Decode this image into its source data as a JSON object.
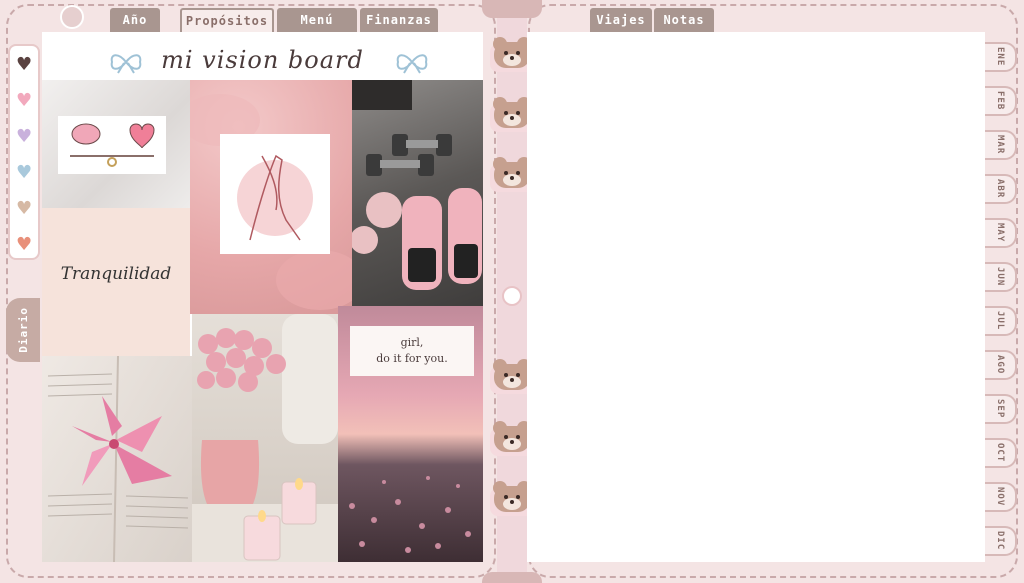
{
  "top_tabs": {
    "anio": "Año",
    "propositos": "Propósitos",
    "menu": "Menú",
    "finanzas": "Finanzas",
    "viajes": "Viajes",
    "notas": "Notas"
  },
  "side_tab": {
    "diario": "Diario"
  },
  "colors": {
    "heart_1": "#5a4240",
    "heart_2": "#f2a9bd",
    "heart_3": "#c9b1dc",
    "heart_4": "#a9c9dc",
    "heart_5": "#d6b9a4",
    "heart_6": "#e8907a",
    "tab_bg": "#a99690",
    "page_bg": "#f4e4e4"
  },
  "board": {
    "title": "mi vision board",
    "tranquilidad": "Tranquilidad",
    "quote_line1": "girl,",
    "quote_line2": "do it for you."
  },
  "months": [
    "ENE",
    "FEB",
    "MAR",
    "ABR",
    "MAY",
    "JUN",
    "JUL",
    "AGO",
    "SEP",
    "OCT",
    "NOV",
    "DIC"
  ]
}
